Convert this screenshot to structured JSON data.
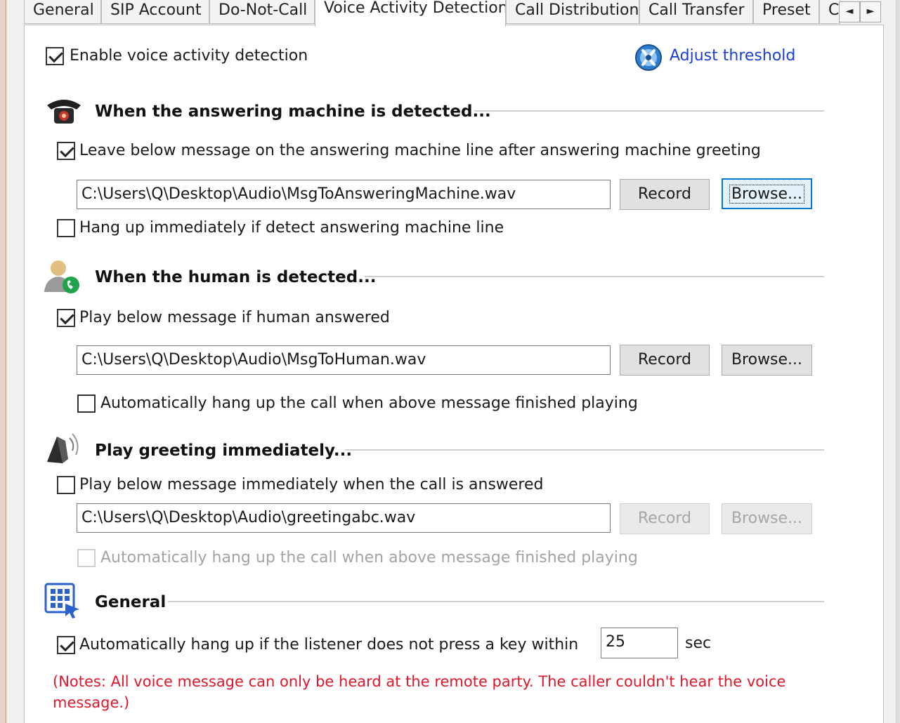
{
  "tabs": [
    {
      "label": "General"
    },
    {
      "label": "SIP Account"
    },
    {
      "label": "Do-Not-Call"
    },
    {
      "label": "Voice Activity Detection"
    },
    {
      "label": "Call Distribution"
    },
    {
      "label": "Call Transfer"
    },
    {
      "label": "Preset"
    },
    {
      "label": "C"
    }
  ],
  "tab_scroll": {
    "left": "◄",
    "right": "►"
  },
  "vad": {
    "enable_label": "Enable voice activity detection",
    "enable_checked": true,
    "adjust_link": "Adjust threshold"
  },
  "machine": {
    "title": "When the answering machine is detected...",
    "leave_label": "Leave below message on the answering machine line after answering machine greeting",
    "leave_checked": true,
    "path": "C:\\Users\\Q\\Desktop\\Audio\\MsgToAnsweringMachine.wav",
    "record_label": "Record",
    "browse_label": "Browse...",
    "hangup_label": "Hang up immediately if detect answering machine line",
    "hangup_checked": false
  },
  "human": {
    "title": "When the human is detected...",
    "play_label": "Play below message if human answered",
    "play_checked": true,
    "path": "C:\\Users\\Q\\Desktop\\Audio\\MsgToHuman.wav",
    "record_label": "Record",
    "browse_label": "Browse...",
    "auto_hangup_label": "Automatically hang up the call when above message finished playing",
    "auto_hangup_checked": false
  },
  "greeting": {
    "title": "Play greeting immediately...",
    "play_label": "Play below message immediately when the call is answered",
    "play_checked": false,
    "path": "C:\\Users\\Q\\Desktop\\Audio\\greetingabc.wav",
    "record_label": "Record",
    "browse_label": "Browse...",
    "auto_hangup_label": "Automatically hang up the call when above message finished playing",
    "auto_hangup_checked": false
  },
  "general": {
    "title": "General",
    "keypress_label": "Automatically hang up if the listener does not press a key within",
    "keypress_checked": true,
    "seconds_value": "25",
    "seconds_unit": "sec",
    "note": "(Notes: All voice message can only be heard at the remote party. The caller couldn't hear the voice message.)"
  },
  "colors": {
    "link": "#1b3fd6",
    "note": "#e0162b",
    "focus": "#0078d7"
  }
}
